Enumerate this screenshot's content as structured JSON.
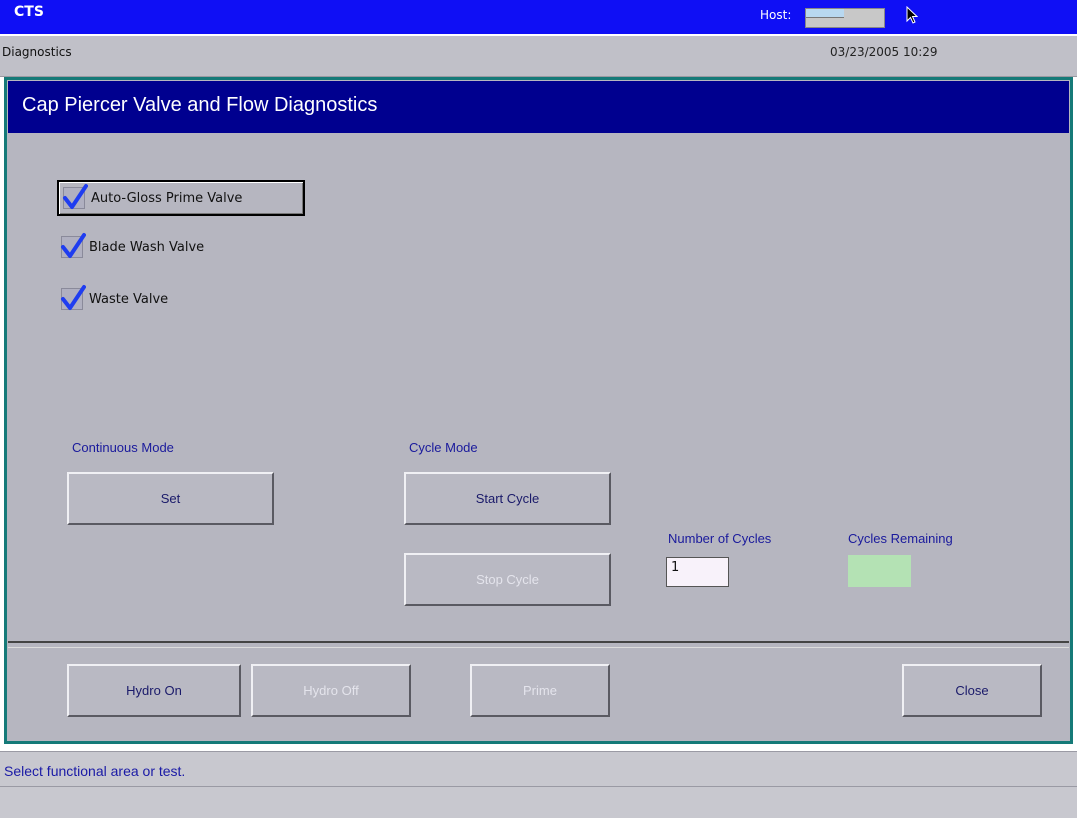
{
  "window": {
    "app_title": "CTS",
    "host_label": "Host:"
  },
  "header": {
    "section": "Diagnostics",
    "datetime": "03/23/2005 10:29"
  },
  "panel": {
    "title": "Cap Piercer Valve and Flow Diagnostics"
  },
  "valves": [
    {
      "label": "Auto-Gloss Prime Valve",
      "checked": true
    },
    {
      "label": "Blade Wash Valve",
      "checked": true
    },
    {
      "label": "Waste Valve",
      "checked": true
    }
  ],
  "continuous_mode": {
    "label": "Continuous Mode",
    "set_button": "Set"
  },
  "cycle_mode": {
    "label": "Cycle Mode",
    "start_button": "Start Cycle",
    "stop_button": "Stop Cycle"
  },
  "number_of_cycles": {
    "label": "Number of Cycles",
    "value": "1"
  },
  "cycles_remaining": {
    "label": "Cycles Remaining",
    "value": ""
  },
  "footer_buttons": {
    "hydro_on": "Hydro On",
    "hydro_off": "Hydro Off",
    "prime": "Prime",
    "close": "Close"
  },
  "status": {
    "message": "Select functional area or test."
  },
  "colors": {
    "title_bar": "#0f0ff5",
    "panel_title": "#00008f",
    "panel_border": "#157a78",
    "check": "#1f3df0",
    "remaining_box": "#b4e2b4"
  },
  "icons": {
    "checkmark": "checkmark-icon",
    "cursor": "mouse-pointer-icon"
  }
}
